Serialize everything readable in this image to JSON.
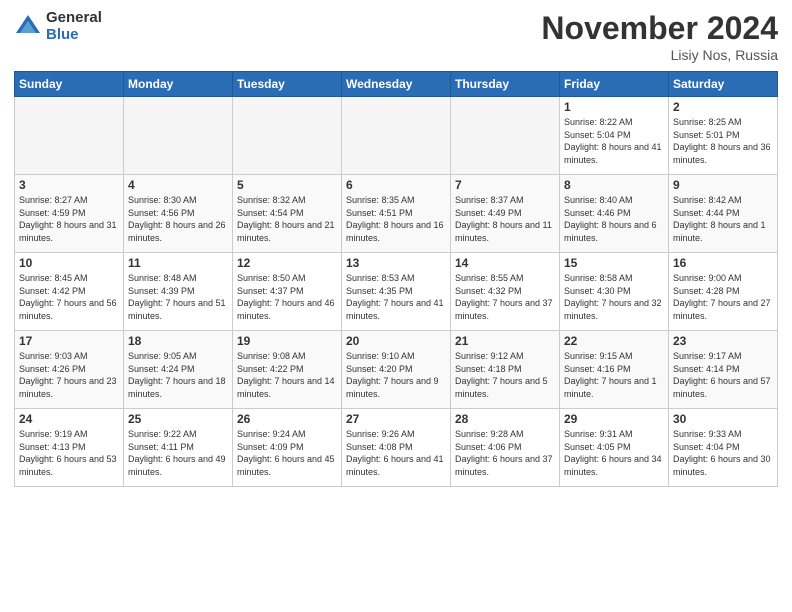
{
  "logo": {
    "general": "General",
    "blue": "Blue"
  },
  "title": {
    "month": "November 2024",
    "location": "Lisiy Nos, Russia"
  },
  "weekdays": [
    "Sunday",
    "Monday",
    "Tuesday",
    "Wednesday",
    "Thursday",
    "Friday",
    "Saturday"
  ],
  "weeks": [
    [
      {
        "day": "",
        "info": ""
      },
      {
        "day": "",
        "info": ""
      },
      {
        "day": "",
        "info": ""
      },
      {
        "day": "",
        "info": ""
      },
      {
        "day": "",
        "info": ""
      },
      {
        "day": "1",
        "info": "Sunrise: 8:22 AM\nSunset: 5:04 PM\nDaylight: 8 hours and 41 minutes."
      },
      {
        "day": "2",
        "info": "Sunrise: 8:25 AM\nSunset: 5:01 PM\nDaylight: 8 hours and 36 minutes."
      }
    ],
    [
      {
        "day": "3",
        "info": "Sunrise: 8:27 AM\nSunset: 4:59 PM\nDaylight: 8 hours and 31 minutes."
      },
      {
        "day": "4",
        "info": "Sunrise: 8:30 AM\nSunset: 4:56 PM\nDaylight: 8 hours and 26 minutes."
      },
      {
        "day": "5",
        "info": "Sunrise: 8:32 AM\nSunset: 4:54 PM\nDaylight: 8 hours and 21 minutes."
      },
      {
        "day": "6",
        "info": "Sunrise: 8:35 AM\nSunset: 4:51 PM\nDaylight: 8 hours and 16 minutes."
      },
      {
        "day": "7",
        "info": "Sunrise: 8:37 AM\nSunset: 4:49 PM\nDaylight: 8 hours and 11 minutes."
      },
      {
        "day": "8",
        "info": "Sunrise: 8:40 AM\nSunset: 4:46 PM\nDaylight: 8 hours and 6 minutes."
      },
      {
        "day": "9",
        "info": "Sunrise: 8:42 AM\nSunset: 4:44 PM\nDaylight: 8 hours and 1 minute."
      }
    ],
    [
      {
        "day": "10",
        "info": "Sunrise: 8:45 AM\nSunset: 4:42 PM\nDaylight: 7 hours and 56 minutes."
      },
      {
        "day": "11",
        "info": "Sunrise: 8:48 AM\nSunset: 4:39 PM\nDaylight: 7 hours and 51 minutes."
      },
      {
        "day": "12",
        "info": "Sunrise: 8:50 AM\nSunset: 4:37 PM\nDaylight: 7 hours and 46 minutes."
      },
      {
        "day": "13",
        "info": "Sunrise: 8:53 AM\nSunset: 4:35 PM\nDaylight: 7 hours and 41 minutes."
      },
      {
        "day": "14",
        "info": "Sunrise: 8:55 AM\nSunset: 4:32 PM\nDaylight: 7 hours and 37 minutes."
      },
      {
        "day": "15",
        "info": "Sunrise: 8:58 AM\nSunset: 4:30 PM\nDaylight: 7 hours and 32 minutes."
      },
      {
        "day": "16",
        "info": "Sunrise: 9:00 AM\nSunset: 4:28 PM\nDaylight: 7 hours and 27 minutes."
      }
    ],
    [
      {
        "day": "17",
        "info": "Sunrise: 9:03 AM\nSunset: 4:26 PM\nDaylight: 7 hours and 23 minutes."
      },
      {
        "day": "18",
        "info": "Sunrise: 9:05 AM\nSunset: 4:24 PM\nDaylight: 7 hours and 18 minutes."
      },
      {
        "day": "19",
        "info": "Sunrise: 9:08 AM\nSunset: 4:22 PM\nDaylight: 7 hours and 14 minutes."
      },
      {
        "day": "20",
        "info": "Sunrise: 9:10 AM\nSunset: 4:20 PM\nDaylight: 7 hours and 9 minutes."
      },
      {
        "day": "21",
        "info": "Sunrise: 9:12 AM\nSunset: 4:18 PM\nDaylight: 7 hours and 5 minutes."
      },
      {
        "day": "22",
        "info": "Sunrise: 9:15 AM\nSunset: 4:16 PM\nDaylight: 7 hours and 1 minute."
      },
      {
        "day": "23",
        "info": "Sunrise: 9:17 AM\nSunset: 4:14 PM\nDaylight: 6 hours and 57 minutes."
      }
    ],
    [
      {
        "day": "24",
        "info": "Sunrise: 9:19 AM\nSunset: 4:13 PM\nDaylight: 6 hours and 53 minutes."
      },
      {
        "day": "25",
        "info": "Sunrise: 9:22 AM\nSunset: 4:11 PM\nDaylight: 6 hours and 49 minutes."
      },
      {
        "day": "26",
        "info": "Sunrise: 9:24 AM\nSunset: 4:09 PM\nDaylight: 6 hours and 45 minutes."
      },
      {
        "day": "27",
        "info": "Sunrise: 9:26 AM\nSunset: 4:08 PM\nDaylight: 6 hours and 41 minutes."
      },
      {
        "day": "28",
        "info": "Sunrise: 9:28 AM\nSunset: 4:06 PM\nDaylight: 6 hours and 37 minutes."
      },
      {
        "day": "29",
        "info": "Sunrise: 9:31 AM\nSunset: 4:05 PM\nDaylight: 6 hours and 34 minutes."
      },
      {
        "day": "30",
        "info": "Sunrise: 9:33 AM\nSunset: 4:04 PM\nDaylight: 6 hours and 30 minutes."
      }
    ]
  ]
}
